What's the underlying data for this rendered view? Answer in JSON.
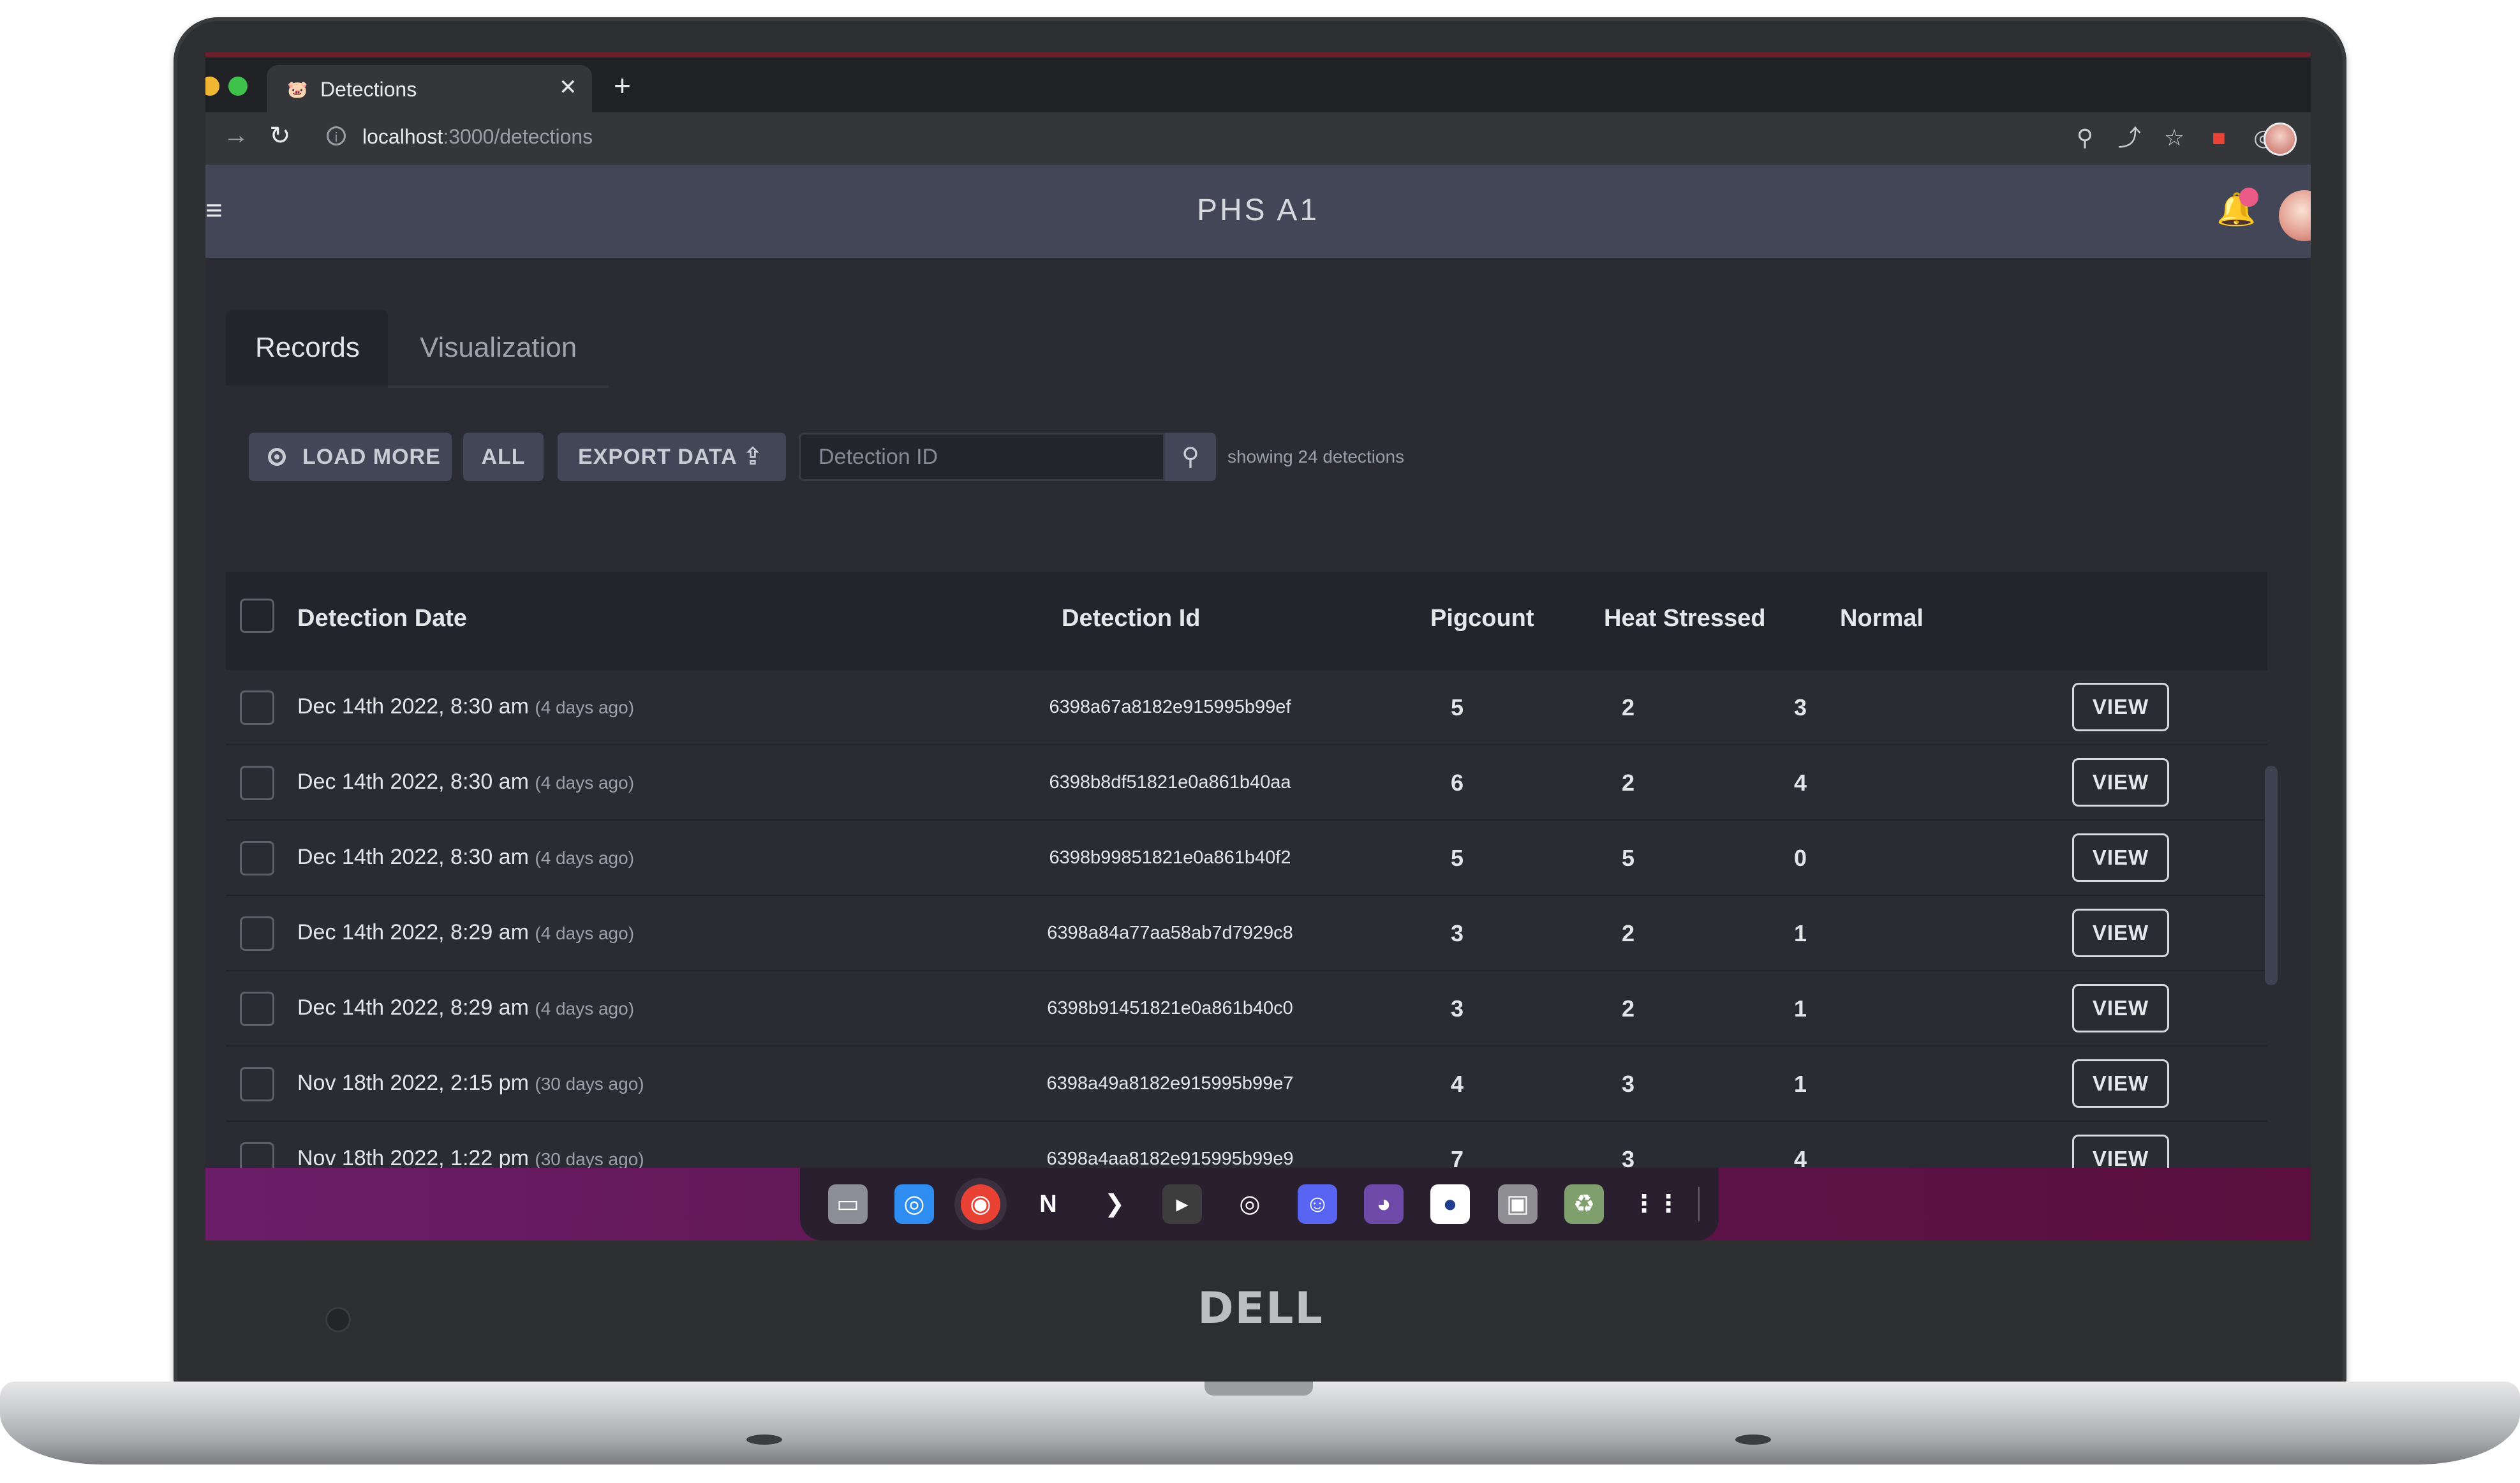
{
  "browser": {
    "tab_title": "Detections",
    "tab_favicon": "🐷",
    "url_host": "localhost",
    "url_path": ":3000/detections"
  },
  "header": {
    "title": "PHS A1"
  },
  "tabs": [
    {
      "label": "Records"
    },
    {
      "label": "Visualization"
    }
  ],
  "toolbar": {
    "load_more": "LOAD MORE",
    "all": "ALL",
    "export": "EXPORT DATA",
    "search_placeholder": "Detection ID",
    "showing": "showing 24 detections"
  },
  "table": {
    "headers": [
      "Detection Date",
      "Detection Id",
      "Pigcount",
      "Heat Stressed",
      "Normal"
    ],
    "view_label": "VIEW",
    "rows": [
      {
        "date": "Dec 14th 2022, 8:30 am",
        "ago": "(4 days ago)",
        "id": "6398a67a8182e915995b99ef",
        "pigcount": "5",
        "heat": "2",
        "normal": "3"
      },
      {
        "date": "Dec 14th 2022, 8:30 am",
        "ago": "(4 days ago)",
        "id": "6398b8df51821e0a861b40aa",
        "pigcount": "6",
        "heat": "2",
        "normal": "4"
      },
      {
        "date": "Dec 14th 2022, 8:30 am",
        "ago": "(4 days ago)",
        "id": "6398b99851821e0a861b40f2",
        "pigcount": "5",
        "heat": "5",
        "normal": "0"
      },
      {
        "date": "Dec 14th 2022, 8:29 am",
        "ago": "(4 days ago)",
        "id": "6398a84a77aa58ab7d7929c8",
        "pigcount": "3",
        "heat": "2",
        "normal": "1"
      },
      {
        "date": "Dec 14th 2022, 8:29 am",
        "ago": "(4 days ago)",
        "id": "6398b91451821e0a861b40c0",
        "pigcount": "3",
        "heat": "2",
        "normal": "1"
      },
      {
        "date": "Nov 18th 2022, 2:15 pm",
        "ago": "(30 days ago)",
        "id": "6398a49a8182e915995b99e7",
        "pigcount": "4",
        "heat": "3",
        "normal": "1"
      },
      {
        "date": "Nov 18th 2022, 1:22 pm",
        "ago": "(30 days ago)",
        "id": "6398a4aa8182e915995b99e9",
        "pigcount": "7",
        "heat": "3",
        "normal": "4"
      }
    ]
  },
  "laptop": {
    "brand": "DELL"
  },
  "dock": {
    "apps": [
      "files-icon",
      "browser-icon",
      "chrome-icon",
      "notion-icon",
      "vscode-icon",
      "terminal-icon",
      "obs-icon",
      "discord-icon",
      "github-icon",
      "app-icon",
      "drive-icon",
      "trash-icon",
      "app-grid-icon"
    ]
  },
  "colors": {
    "header_bg": "#424657",
    "content_bg": "#2b2c33",
    "table_header_bg": "#24252c",
    "notification_dot": "#ec5b87",
    "dock_bg": "#6c1d68"
  }
}
